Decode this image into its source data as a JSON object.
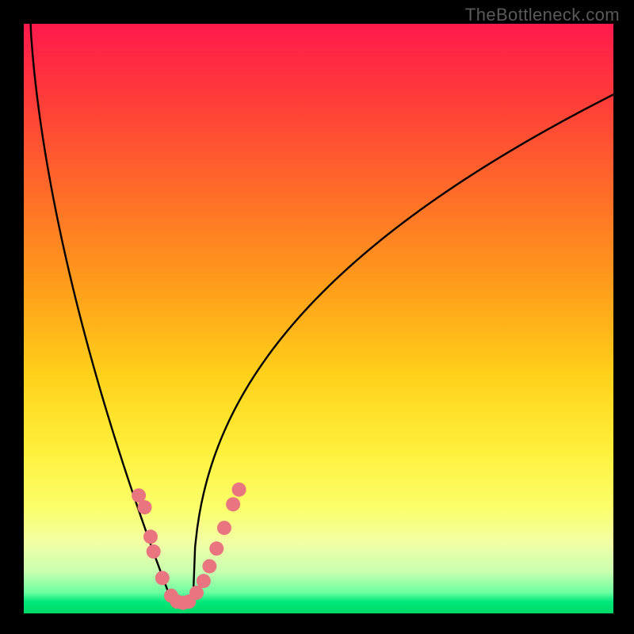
{
  "watermark": "TheBottleneck.com",
  "chart_data": {
    "type": "line",
    "title": "",
    "xlabel": "",
    "ylabel": "",
    "xrange": [
      0,
      100
    ],
    "yrange": [
      0,
      100
    ],
    "notes": "Bottleneck-style curve on a vertical red→green gradient background. No numeric tick labels visible; values represent relative plot-area coordinates (0–100 along each axis, origin top-left for y=0 at top).",
    "series": [
      {
        "name": "bottleneck-curve",
        "color": "#000000",
        "x": [
          0,
          3,
          7,
          10,
          13,
          16,
          19,
          22,
          24,
          26,
          28,
          30,
          33,
          36,
          40,
          45,
          52,
          60,
          70,
          80,
          90,
          100
        ],
        "y": [
          0,
          22,
          42,
          55,
          66,
          76,
          84,
          90,
          94,
          97,
          98,
          97,
          93,
          86,
          77,
          67,
          56,
          45,
          35,
          27,
          20,
          14
        ]
      }
    ],
    "markers": [
      {
        "x": 19.5,
        "y": 80
      },
      {
        "x": 20.5,
        "y": 82
      },
      {
        "x": 21.5,
        "y": 87
      },
      {
        "x": 22,
        "y": 89.5
      },
      {
        "x": 23.5,
        "y": 94
      },
      {
        "x": 25,
        "y": 97
      },
      {
        "x": 26,
        "y": 98
      },
      {
        "x": 27,
        "y": 98.2
      },
      {
        "x": 28,
        "y": 98
      },
      {
        "x": 29.3,
        "y": 96.5
      },
      {
        "x": 30.5,
        "y": 94.5
      },
      {
        "x": 31.5,
        "y": 92
      },
      {
        "x": 32.7,
        "y": 89
      },
      {
        "x": 34,
        "y": 85.5
      },
      {
        "x": 35.5,
        "y": 81.5
      },
      {
        "x": 36.5,
        "y": 79
      }
    ],
    "marker_style": {
      "color": "#e97580",
      "radius_px": 9
    }
  }
}
